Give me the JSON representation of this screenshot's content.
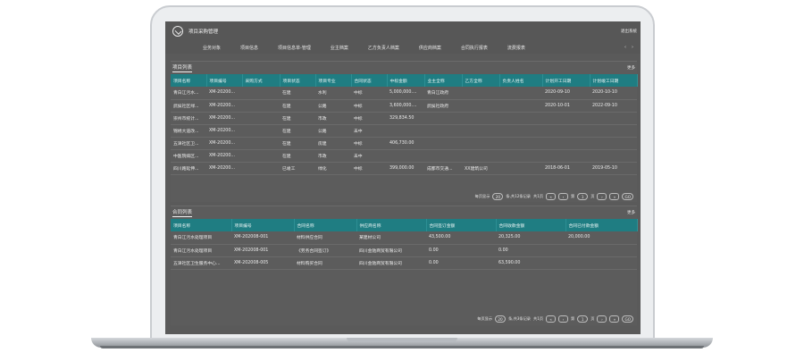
{
  "app": {
    "title": "项目采购管理",
    "logout_label": "退出系统"
  },
  "nav": {
    "items": [
      "业务对象",
      "项目信息",
      "项目信息单-管理",
      "业主档案",
      "乙方负责人档案",
      "供应商档案",
      "合同执行报表",
      "流费报表"
    ],
    "arrows": [
      "‹",
      "›"
    ]
  },
  "projects": {
    "title": "项目列表",
    "more": "更多",
    "columns": [
      "项目名称",
      "项目编号",
      "采购方式",
      "项目状态",
      "项目专业",
      "合同状态",
      "中标金额",
      "业主全称",
      "乙方全称",
      "负责人姓名",
      "计划开工日期",
      "计划竣工日期"
    ],
    "rows": [
      [
        "青白江污水...",
        "XM-20200...",
        "",
        "在建",
        "水利",
        "中标",
        "5,000,000....",
        "青白江政府",
        "",
        "",
        "2020-09-10",
        "2020-10-10"
      ],
      [
        "武侯社区绿...",
        "XM-20200...",
        "",
        "在建",
        "公路",
        "中标",
        "3,600,000....",
        "武侯社政府",
        "",
        "",
        "2020-10-01",
        "2022-09-10"
      ],
      [
        "崇州市统计...",
        "XM-20200...",
        "",
        "在建",
        "市政",
        "中标",
        "329,834.50",
        "",
        "",
        "",
        "",
        ""
      ],
      [
        "锦绣大道改...",
        "XM-20200...",
        "",
        "在建",
        "公路",
        "未中",
        "",
        "",
        "",
        "",
        "",
        ""
      ],
      [
        "五津社区卫...",
        "XM-20200...",
        "",
        "在建",
        "房建",
        "中标",
        "406,730.00",
        "",
        "",
        "",
        "",
        ""
      ],
      [
        "中医院病区...",
        "XM-20200...",
        "",
        "在建",
        "市政",
        "未中",
        "",
        "",
        "",
        "",
        "",
        ""
      ],
      [
        "四川路延伸...",
        "XM-20200...",
        "",
        "已竣工",
        "绿化",
        "中标",
        "399,000.00",
        "成都市交通...",
        "XX建筑公司",
        "",
        "2018-06-01",
        "2019-05-10"
      ]
    ],
    "pager": {
      "per_page_label": "每页显示",
      "per_page": "20",
      "count_label": "条,共12条记录",
      "pages_label": "共1页",
      "first": "«",
      "prev": "‹",
      "page_prefix": "第",
      "page": "1",
      "page_suffix": "页",
      "next": "›",
      "last": "»",
      "go": "GO"
    }
  },
  "contracts": {
    "title": "合同列表",
    "more": "更多",
    "columns": [
      "项目名称",
      "项目编号",
      "合同名称",
      "供应商名称",
      "合同签订金额",
      "合同收款金额",
      "合同已付款金额"
    ],
    "rows": [
      [
        "青白江污水处理项目",
        "XM-202008-001",
        "材料供应合同",
        "某建材公司",
        "43,500.00",
        "20,325.00",
        "20,000.00"
      ],
      [
        "青白江污水处理项目",
        "XM-202008-001",
        "《劳务合同签订》",
        "四川金驰商贸有限公司",
        "0.00",
        "0.00",
        ""
      ],
      [
        "五津社区卫生服务中心...",
        "XM-202008-005",
        "材料购买合同",
        "四川金驰商贸有限公司",
        "0.00",
        "63,590.00",
        ""
      ]
    ],
    "pager": {
      "per_page_label": "每页显示",
      "per_page": "20",
      "count_label": "条,共3条记录",
      "pages_label": "共1页",
      "first": "«",
      "prev": "‹",
      "page_prefix": "第",
      "page": "1",
      "page_suffix": "页",
      "next": "›",
      "last": "»",
      "go": "GO"
    }
  }
}
